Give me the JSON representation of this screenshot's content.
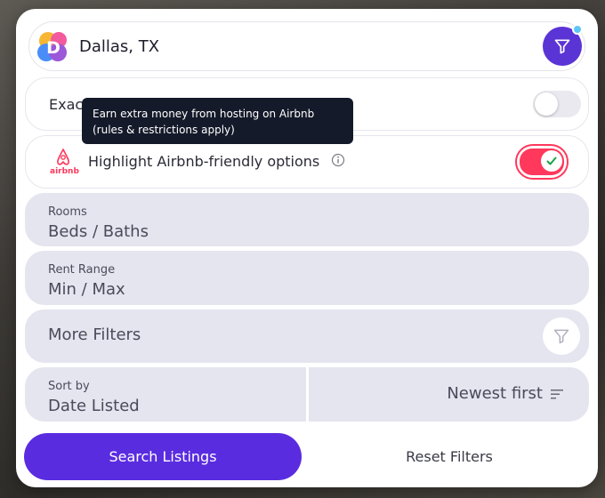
{
  "search": {
    "city": "Dallas, TX"
  },
  "exact_match": {
    "label_visible": "Exac"
  },
  "tooltip": {
    "text": "Earn extra money from hosting on Airbnb (rules & restrictions apply)"
  },
  "airbnb": {
    "logo_word": "airbnb",
    "label": "Highlight Airbnb-friendly options",
    "enabled": true
  },
  "rooms": {
    "label": "Rooms",
    "value": "Beds / Baths"
  },
  "rent_range": {
    "label": "Rent Range",
    "value": "Min / Max"
  },
  "more_filters": {
    "label": "More Filters"
  },
  "sort": {
    "label": "Sort by",
    "value": "Date Listed",
    "order": "Newest first"
  },
  "actions": {
    "search": "Search Listings",
    "reset": "Reset Filters"
  },
  "colors": {
    "accent": "#5a2ce0",
    "airbnb": "#ff385c",
    "badge": "#5ec6f7",
    "tooltip_bg": "#141a2a",
    "field_bg": "#e5e5f0"
  },
  "icons": [
    "app-logo-icon",
    "filter-icon",
    "airbnb-logo-icon",
    "info-icon",
    "check-icon",
    "sort-lines-icon"
  ]
}
